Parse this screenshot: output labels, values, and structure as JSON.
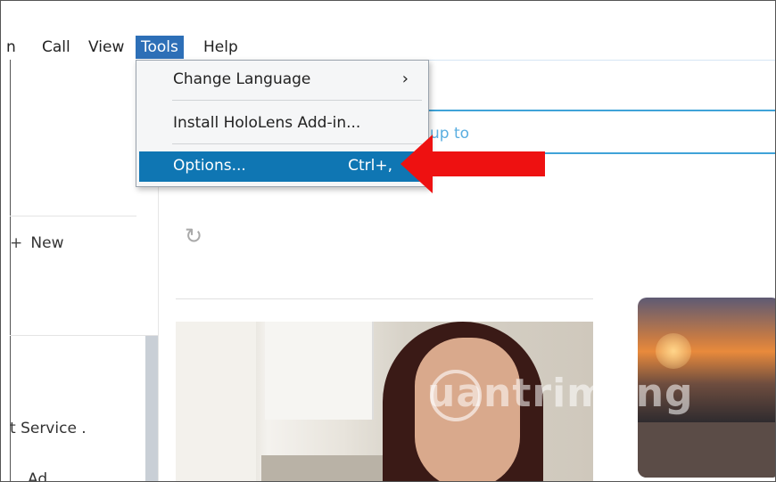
{
  "menubar": {
    "items": [
      {
        "label": "n"
      },
      {
        "label": "Call"
      },
      {
        "label": "View"
      },
      {
        "label": "Tools"
      },
      {
        "label": "Help"
      }
    ]
  },
  "dropdown": {
    "items": [
      {
        "label": "Change Language",
        "submenu_arrow": "›"
      },
      {
        "label": "Install HoloLens Add-in..."
      },
      {
        "label": "Options...",
        "shortcut": "Ctrl+,"
      }
    ]
  },
  "leftpane": {
    "new_label": "New",
    "service_text": "t Service .",
    "partial_text": "Ad..."
  },
  "search": {
    "partial_placeholder": "up to"
  },
  "watermark": "uantrimang",
  "colors": {
    "accent": "#0f76b3",
    "menu_active": "#2d6fb7",
    "search_border": "#3fa3d8",
    "arrow": "#ee1111"
  }
}
